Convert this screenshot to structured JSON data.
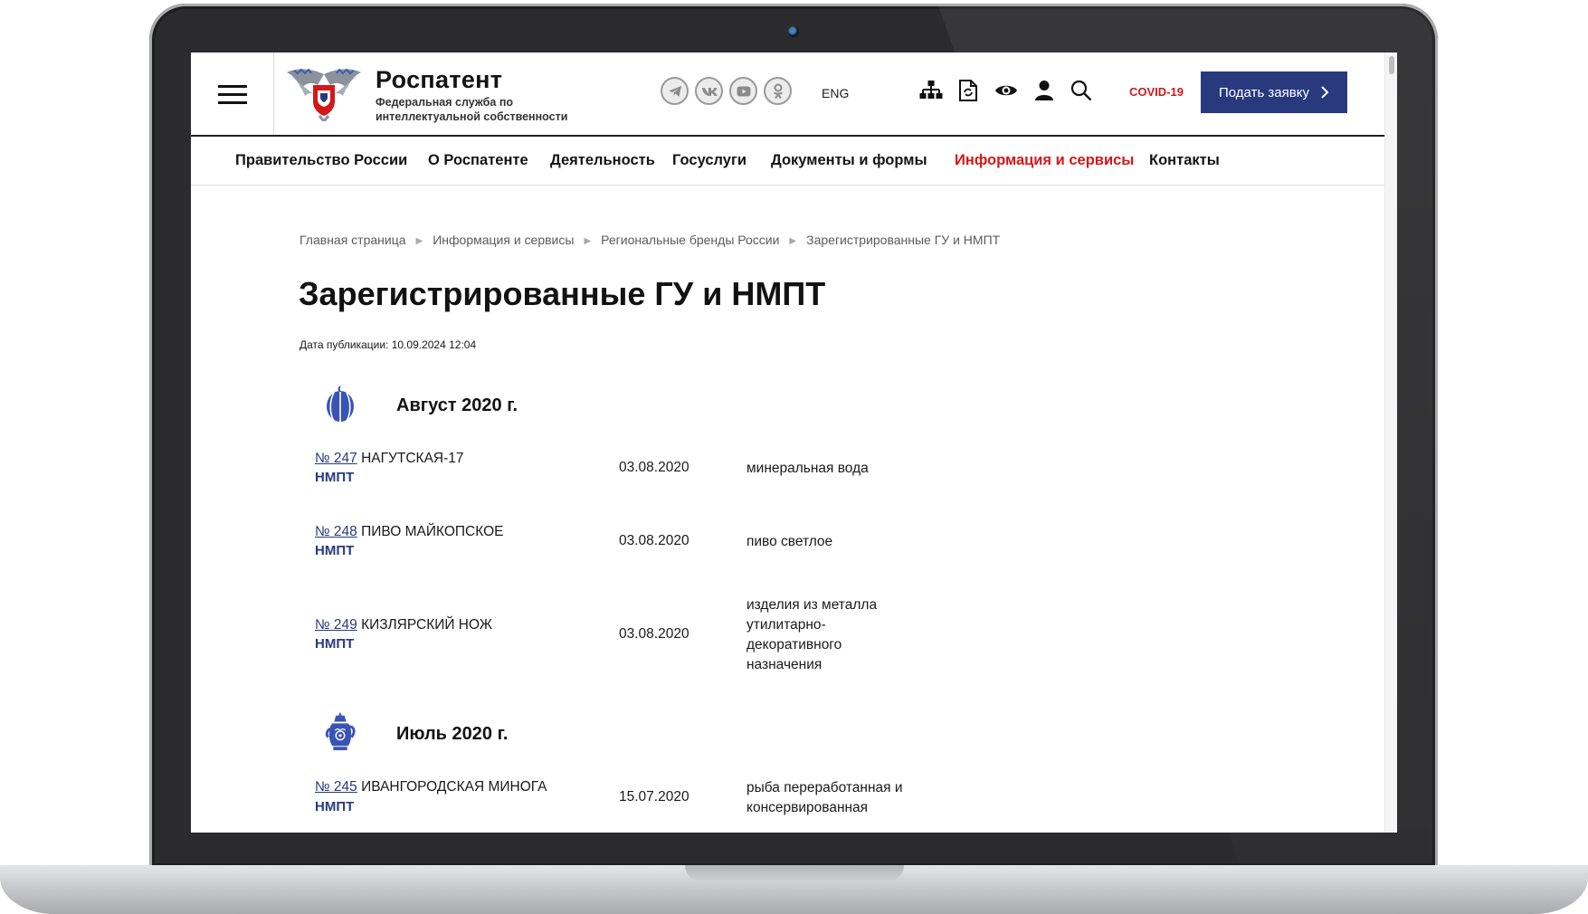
{
  "header": {
    "brand_name": "Роспатент",
    "brand_sub": "Федеральная служба по интеллектуальной собственности",
    "lang": "ENG",
    "covid": "COVID-19",
    "apply_button": "Подать заявку"
  },
  "nav": {
    "items": [
      {
        "label": "Правительство России"
      },
      {
        "label": "О Роспатенте"
      },
      {
        "label": "Деятельность"
      },
      {
        "label": "Госуслуги"
      },
      {
        "label": "Документы и формы"
      },
      {
        "label": "Информация и сервисы"
      },
      {
        "label": "Контакты"
      }
    ],
    "active_color": "#d3181b"
  },
  "breadcrumb": [
    "Главная страница",
    "Информация и сервисы",
    "Региональные бренды России",
    "Зарегистрированные ГУ и НМПТ"
  ],
  "page": {
    "title": "Зарегистрированные ГУ и НМПТ",
    "pub_date": "Дата публикации: 10.09.2024 12:04"
  },
  "months": [
    {
      "title": "Август 2020 г.",
      "icon": "watermelon-icon",
      "entries": [
        {
          "num": "№ 247",
          "name": "НАГУТСКАЯ-17",
          "type": "НМПТ",
          "date": "03.08.2020",
          "desc": "минеральная вода"
        },
        {
          "num": "№ 248",
          "name": "ПИВО МАЙКОПСКОЕ",
          "type": "НМПТ",
          "date": "03.08.2020",
          "desc": "пиво светлое"
        },
        {
          "num": "№ 249",
          "name": "КИЗЛЯРСКИЙ НОЖ",
          "type": "НМПТ",
          "date": "03.08.2020",
          "desc": "изделия из металла утилитарно-декоративного назначения"
        }
      ]
    },
    {
      "title": "Июль 2020 г.",
      "icon": "teapot-icon",
      "entries": [
        {
          "num": "№ 245",
          "name": "ИВАНГОРОДСКАЯ МИНОГА",
          "type": "НМПТ",
          "date": "15.07.2020",
          "desc": "рыба переработанная и консервированная"
        }
      ]
    }
  ],
  "colors": {
    "accent_blue": "#283a7d",
    "accent_red": "#d3181b"
  }
}
